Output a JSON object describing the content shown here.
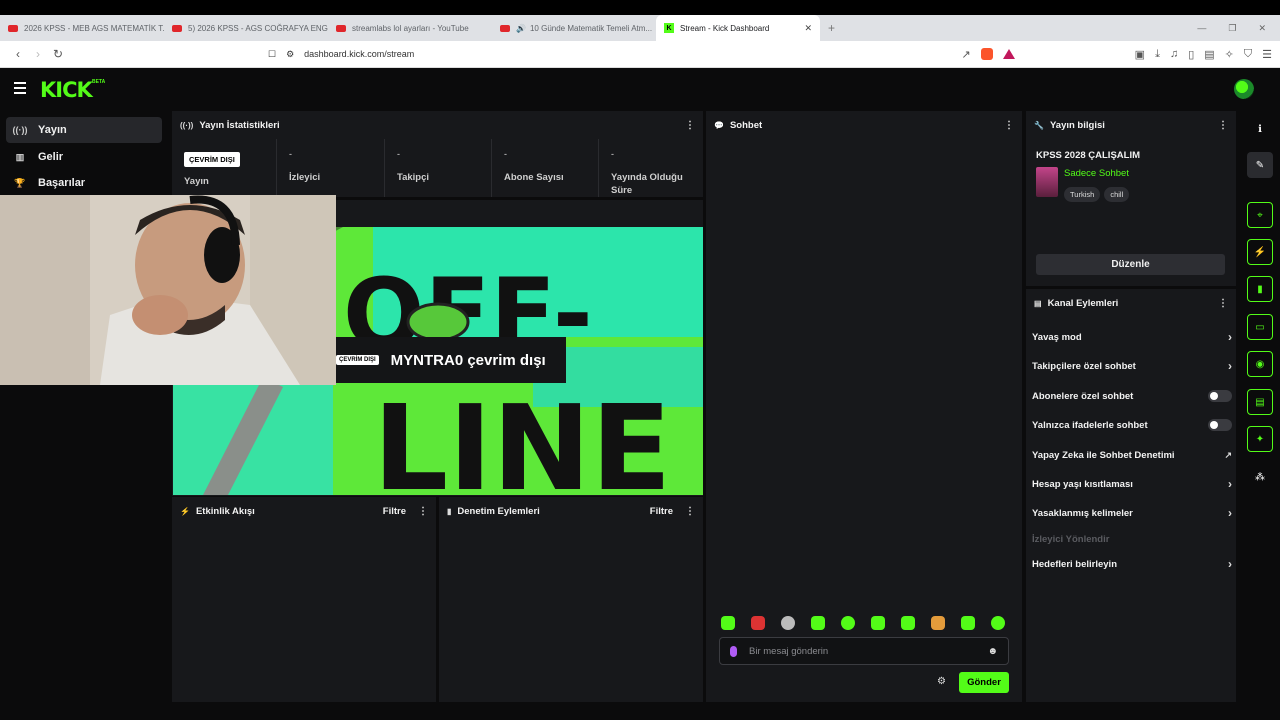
{
  "browser": {
    "tabs": [
      {
        "label": "2026 KPSS - MEB AGS MATEMATİK T..."
      },
      {
        "label": "5) 2026 KPSS - AGS COĞRAFYA ENGİ..."
      },
      {
        "label": "streamlabs lol ayarları - YouTube"
      },
      {
        "label": "10 Günde Matematik Temeli Atm..."
      },
      {
        "label": "Stream - Kick Dashboard"
      }
    ],
    "url": "dashboard.kick.com/stream"
  },
  "kick": {
    "logo": "KICK",
    "beta": "BETA"
  },
  "sidebar": {
    "items": [
      {
        "label": "Yayın"
      },
      {
        "label": "Gelir"
      },
      {
        "label": "Başarılar"
      }
    ]
  },
  "stats": {
    "title": "Yayın İstatistikleri",
    "offline_badge": "ÇEVRİM DIŞI",
    "cells": [
      {
        "value": "",
        "label": "Yayın"
      },
      {
        "value": "-",
        "label": "İzleyici"
      },
      {
        "value": "-",
        "label": "Takipçi"
      },
      {
        "value": "-",
        "label": "Abone Sayısı"
      },
      {
        "value": "-",
        "label": "Yayında Olduğu Süre"
      }
    ]
  },
  "player": {
    "offline_badge": "ÇEVRİM DIŞI",
    "offline_text": "MYNTRA0 çevrim dışı",
    "art_text_1": "OFF-",
    "art_text_2": "LINE"
  },
  "activity": {
    "title": "Etkinlik Akışı",
    "filter": "Filtre"
  },
  "moderation": {
    "title": "Denetim Eylemleri",
    "filter": "Filtre"
  },
  "chat": {
    "title": "Sohbet",
    "placeholder": "Bir mesaj gönderin",
    "send": "Gönder"
  },
  "stream_info": {
    "title": "Yayın bilgisi",
    "stream_title": "KPSS 2028 ÇALIŞALIM",
    "category": "Sadece Sohbet",
    "tags": [
      "Turkish",
      "chill"
    ],
    "edit": "Düzenle"
  },
  "channel_actions": {
    "title": "Kanal Eylemleri",
    "items": [
      {
        "label": "Yavaş mod",
        "type": "chevron"
      },
      {
        "label": "Takipçilere özel sohbet",
        "type": "chevron"
      },
      {
        "label": "Abonelere özel sohbet",
        "type": "toggle"
      },
      {
        "label": "Yalnızca ifadelerle sohbet",
        "type": "toggle"
      },
      {
        "label": "Yapay Zeka ile Sohbet Denetimi",
        "type": "external"
      },
      {
        "label": "Hesap yaşı kısıtlaması",
        "type": "chevron"
      },
      {
        "label": "Yasaklanmış kelimeler",
        "type": "chevron"
      },
      {
        "label": "İzleyici Yönlendir",
        "type": "disabled"
      },
      {
        "label": "Hedefleri belirleyin",
        "type": "chevron"
      }
    ]
  },
  "colors": {
    "accent": "#53fc18",
    "panel": "#17181b",
    "bg": "#0b0b0c"
  }
}
